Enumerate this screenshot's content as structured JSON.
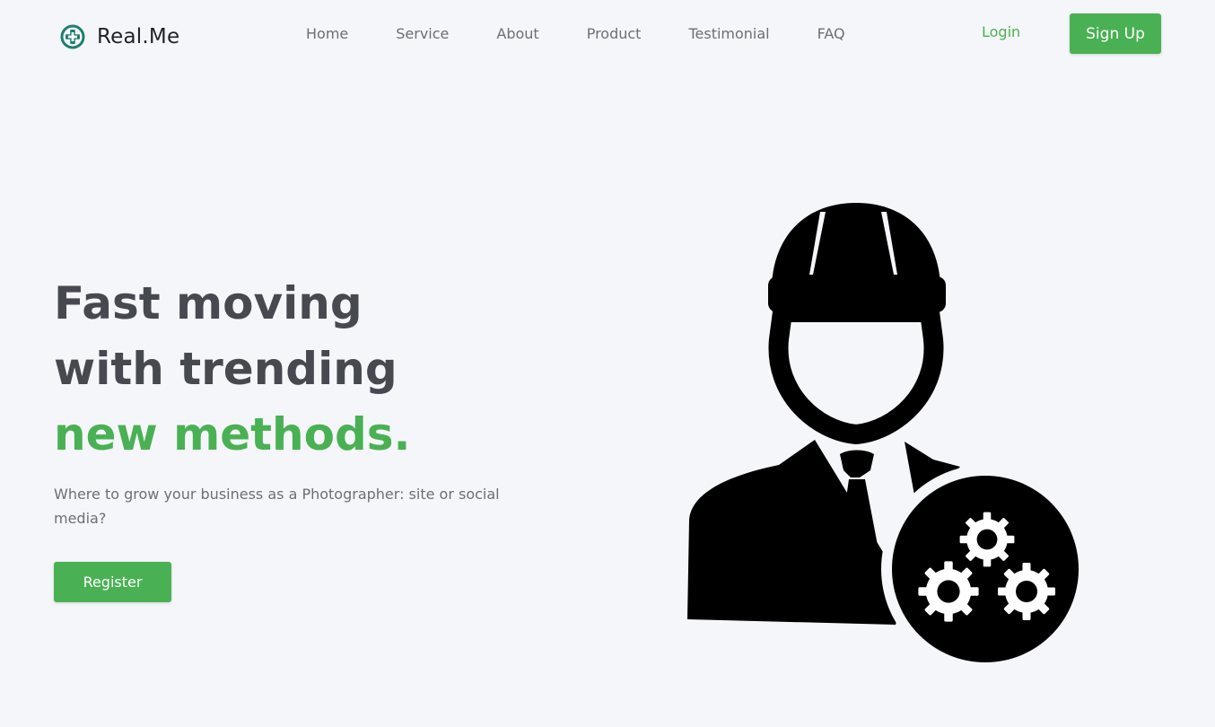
{
  "header": {
    "brand_name": "Real.Me",
    "nav": [
      "Home",
      "Service",
      "About",
      "Product",
      "Testimonial",
      "FAQ"
    ],
    "login_label": "Login",
    "signup_label": "Sign Up"
  },
  "hero": {
    "title_line1": "Fast moving",
    "title_line2": "with trending",
    "title_line3": "new methods.",
    "subtitle": "Where to grow your business as a Photographer: site or social media?",
    "register_label": "Register"
  },
  "colors": {
    "accent": "#49b153",
    "heading": "#464a50",
    "body_text": "#6b6f76",
    "background": "#f5f6fa",
    "logo_teal": "#1f7f6e"
  },
  "icons": {
    "brand": "medical-cross-logo-icon",
    "illustration": "engineer-with-gears-icon"
  }
}
